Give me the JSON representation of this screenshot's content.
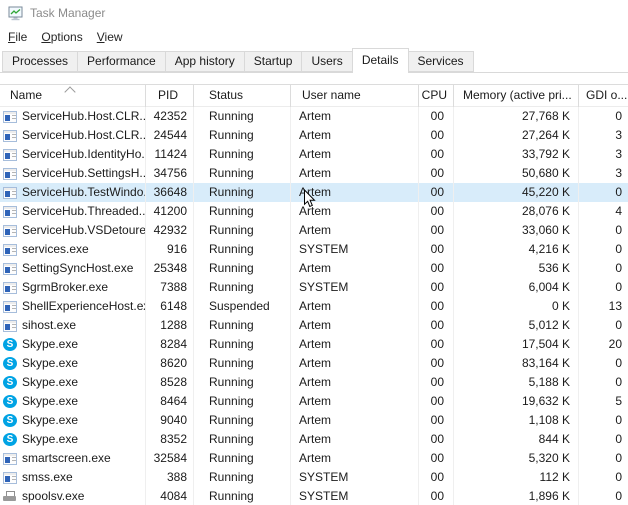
{
  "window": {
    "title": "Task Manager"
  },
  "menu": {
    "items": [
      {
        "label": "File"
      },
      {
        "label": "Options"
      },
      {
        "label": "View"
      }
    ]
  },
  "tabs": [
    {
      "label": "Processes",
      "selected": false
    },
    {
      "label": "Performance",
      "selected": false
    },
    {
      "label": "App history",
      "selected": false
    },
    {
      "label": "Startup",
      "selected": false
    },
    {
      "label": "Users",
      "selected": false
    },
    {
      "label": "Details",
      "selected": true
    },
    {
      "label": "Services",
      "selected": false
    }
  ],
  "table": {
    "columns": [
      {
        "id": "name",
        "label": "Name",
        "sort": "asc"
      },
      {
        "id": "pid",
        "label": "PID"
      },
      {
        "id": "status",
        "label": "Status"
      },
      {
        "id": "user",
        "label": "User name"
      },
      {
        "id": "cpu",
        "label": "CPU"
      },
      {
        "id": "memory",
        "label": "Memory (active pri..."
      },
      {
        "id": "gdi",
        "label": "GDI o..."
      }
    ],
    "rows": [
      {
        "icon": "app",
        "name": "ServiceHub.Host.CLR....",
        "pid": "42352",
        "status": "Running",
        "user": "Artem",
        "cpu": "00",
        "memory": "27,768 K",
        "gdi": "0",
        "highlighted": false
      },
      {
        "icon": "app",
        "name": "ServiceHub.Host.CLR....",
        "pid": "24544",
        "status": "Running",
        "user": "Artem",
        "cpu": "00",
        "memory": "27,264 K",
        "gdi": "3",
        "highlighted": false
      },
      {
        "icon": "app",
        "name": "ServiceHub.IdentityHo...",
        "pid": "11424",
        "status": "Running",
        "user": "Artem",
        "cpu": "00",
        "memory": "33,792 K",
        "gdi": "3",
        "highlighted": false
      },
      {
        "icon": "app",
        "name": "ServiceHub.SettingsH...",
        "pid": "34756",
        "status": "Running",
        "user": "Artem",
        "cpu": "00",
        "memory": "50,680 K",
        "gdi": "3",
        "highlighted": false
      },
      {
        "icon": "app",
        "name": "ServiceHub.TestWindo...",
        "pid": "36648",
        "status": "Running",
        "user": "Artem",
        "cpu": "00",
        "memory": "45,220 K",
        "gdi": "0",
        "highlighted": true
      },
      {
        "icon": "app",
        "name": "ServiceHub.Threaded...",
        "pid": "41200",
        "status": "Running",
        "user": "Artem",
        "cpu": "00",
        "memory": "28,076 K",
        "gdi": "4",
        "highlighted": false
      },
      {
        "icon": "app",
        "name": "ServiceHub.VSDetoure...",
        "pid": "42932",
        "status": "Running",
        "user": "Artem",
        "cpu": "00",
        "memory": "33,060 K",
        "gdi": "0",
        "highlighted": false
      },
      {
        "icon": "app",
        "name": "services.exe",
        "pid": "916",
        "status": "Running",
        "user": "SYSTEM",
        "cpu": "00",
        "memory": "4,216 K",
        "gdi": "0",
        "highlighted": false
      },
      {
        "icon": "app",
        "name": "SettingSyncHost.exe",
        "pid": "25348",
        "status": "Running",
        "user": "Artem",
        "cpu": "00",
        "memory": "536 K",
        "gdi": "0",
        "highlighted": false
      },
      {
        "icon": "app",
        "name": "SgrmBroker.exe",
        "pid": "7388",
        "status": "Running",
        "user": "SYSTEM",
        "cpu": "00",
        "memory": "6,004 K",
        "gdi": "0",
        "highlighted": false
      },
      {
        "icon": "app",
        "name": "ShellExperienceHost.exe",
        "pid": "6148",
        "status": "Suspended",
        "user": "Artem",
        "cpu": "00",
        "memory": "0 K",
        "gdi": "13",
        "highlighted": false
      },
      {
        "icon": "app",
        "name": "sihost.exe",
        "pid": "1288",
        "status": "Running",
        "user": "Artem",
        "cpu": "00",
        "memory": "5,012 K",
        "gdi": "0",
        "highlighted": false
      },
      {
        "icon": "skype",
        "name": "Skype.exe",
        "pid": "8284",
        "status": "Running",
        "user": "Artem",
        "cpu": "00",
        "memory": "17,504 K",
        "gdi": "20",
        "highlighted": false
      },
      {
        "icon": "skype",
        "name": "Skype.exe",
        "pid": "8620",
        "status": "Running",
        "user": "Artem",
        "cpu": "00",
        "memory": "83,164 K",
        "gdi": "0",
        "highlighted": false
      },
      {
        "icon": "skype",
        "name": "Skype.exe",
        "pid": "8528",
        "status": "Running",
        "user": "Artem",
        "cpu": "00",
        "memory": "5,188 K",
        "gdi": "0",
        "highlighted": false
      },
      {
        "icon": "skype",
        "name": "Skype.exe",
        "pid": "8464",
        "status": "Running",
        "user": "Artem",
        "cpu": "00",
        "memory": "19,632 K",
        "gdi": "5",
        "highlighted": false
      },
      {
        "icon": "skype",
        "name": "Skype.exe",
        "pid": "9040",
        "status": "Running",
        "user": "Artem",
        "cpu": "00",
        "memory": "1,108 K",
        "gdi": "0",
        "highlighted": false
      },
      {
        "icon": "skype",
        "name": "Skype.exe",
        "pid": "8352",
        "status": "Running",
        "user": "Artem",
        "cpu": "00",
        "memory": "844 K",
        "gdi": "0",
        "highlighted": false
      },
      {
        "icon": "app",
        "name": "smartscreen.exe",
        "pid": "32584",
        "status": "Running",
        "user": "Artem",
        "cpu": "00",
        "memory": "5,320 K",
        "gdi": "0",
        "highlighted": false
      },
      {
        "icon": "app",
        "name": "smss.exe",
        "pid": "388",
        "status": "Running",
        "user": "SYSTEM",
        "cpu": "00",
        "memory": "112 K",
        "gdi": "0",
        "highlighted": false
      },
      {
        "icon": "printer",
        "name": "spoolsv.exe",
        "pid": "4084",
        "status": "Running",
        "user": "SYSTEM",
        "cpu": "00",
        "memory": "1,896 K",
        "gdi": "0",
        "highlighted": false
      }
    ]
  },
  "colors": {
    "row_highlight": "#d8ecfa",
    "skype_blue": "#00a3e4",
    "app_icon_blue": "#2e63b8",
    "tab_bg": "#f0f0f0",
    "border": "#d9d9d9",
    "title_text": "#8b8b8b"
  },
  "icons": {
    "titlebar": "task-manager-icon",
    "app": "default-exe-icon",
    "skype": "skype-icon",
    "printer": "printer-icon",
    "sort": "sort-ascending-caret",
    "pointer": "mouse-cursor"
  }
}
